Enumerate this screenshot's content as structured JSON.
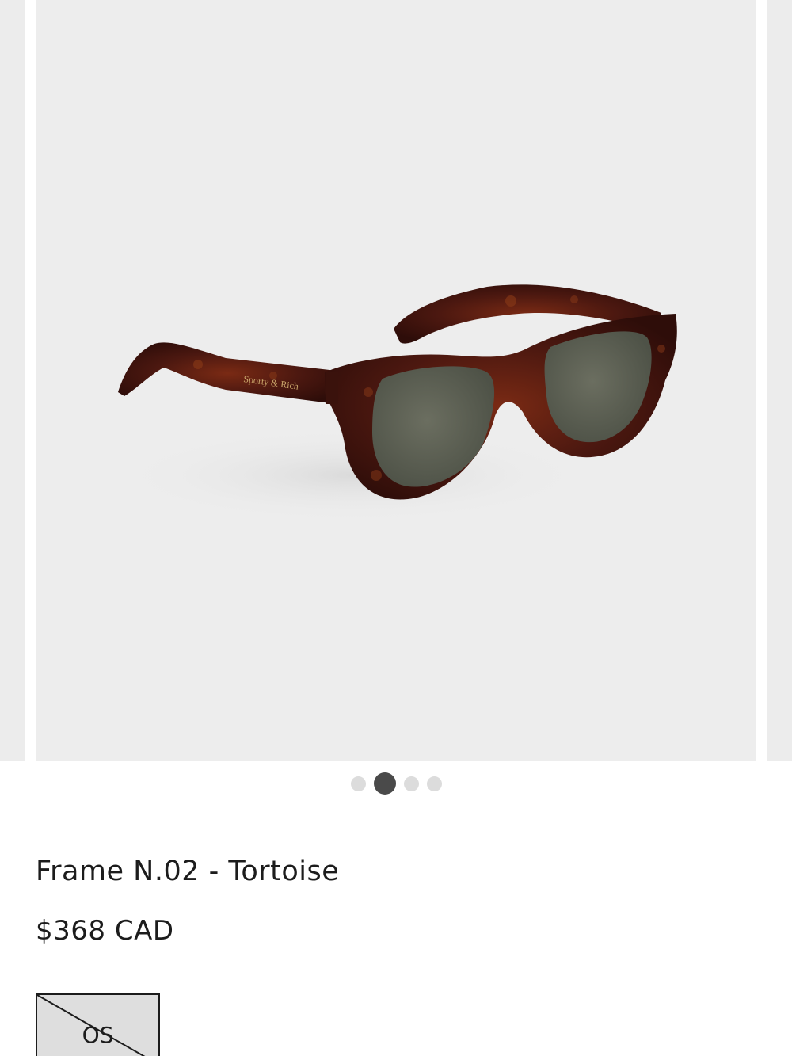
{
  "product": {
    "title": "Frame N.02 - Tortoise",
    "price": "$368 CAD",
    "temple_engraving": "Sporty & Rich"
  },
  "gallery": {
    "image_count": 4,
    "active_index": 1
  },
  "sizes": [
    {
      "label": "OS",
      "available": false
    }
  ],
  "colors": {
    "page_background": "#ffffff",
    "image_background": "#ededed",
    "frame_tortoise": "#4a1a12",
    "lens": "#5f6356",
    "dot_active": "#4a4a4a",
    "dot_inactive": "#dcdcdc"
  }
}
